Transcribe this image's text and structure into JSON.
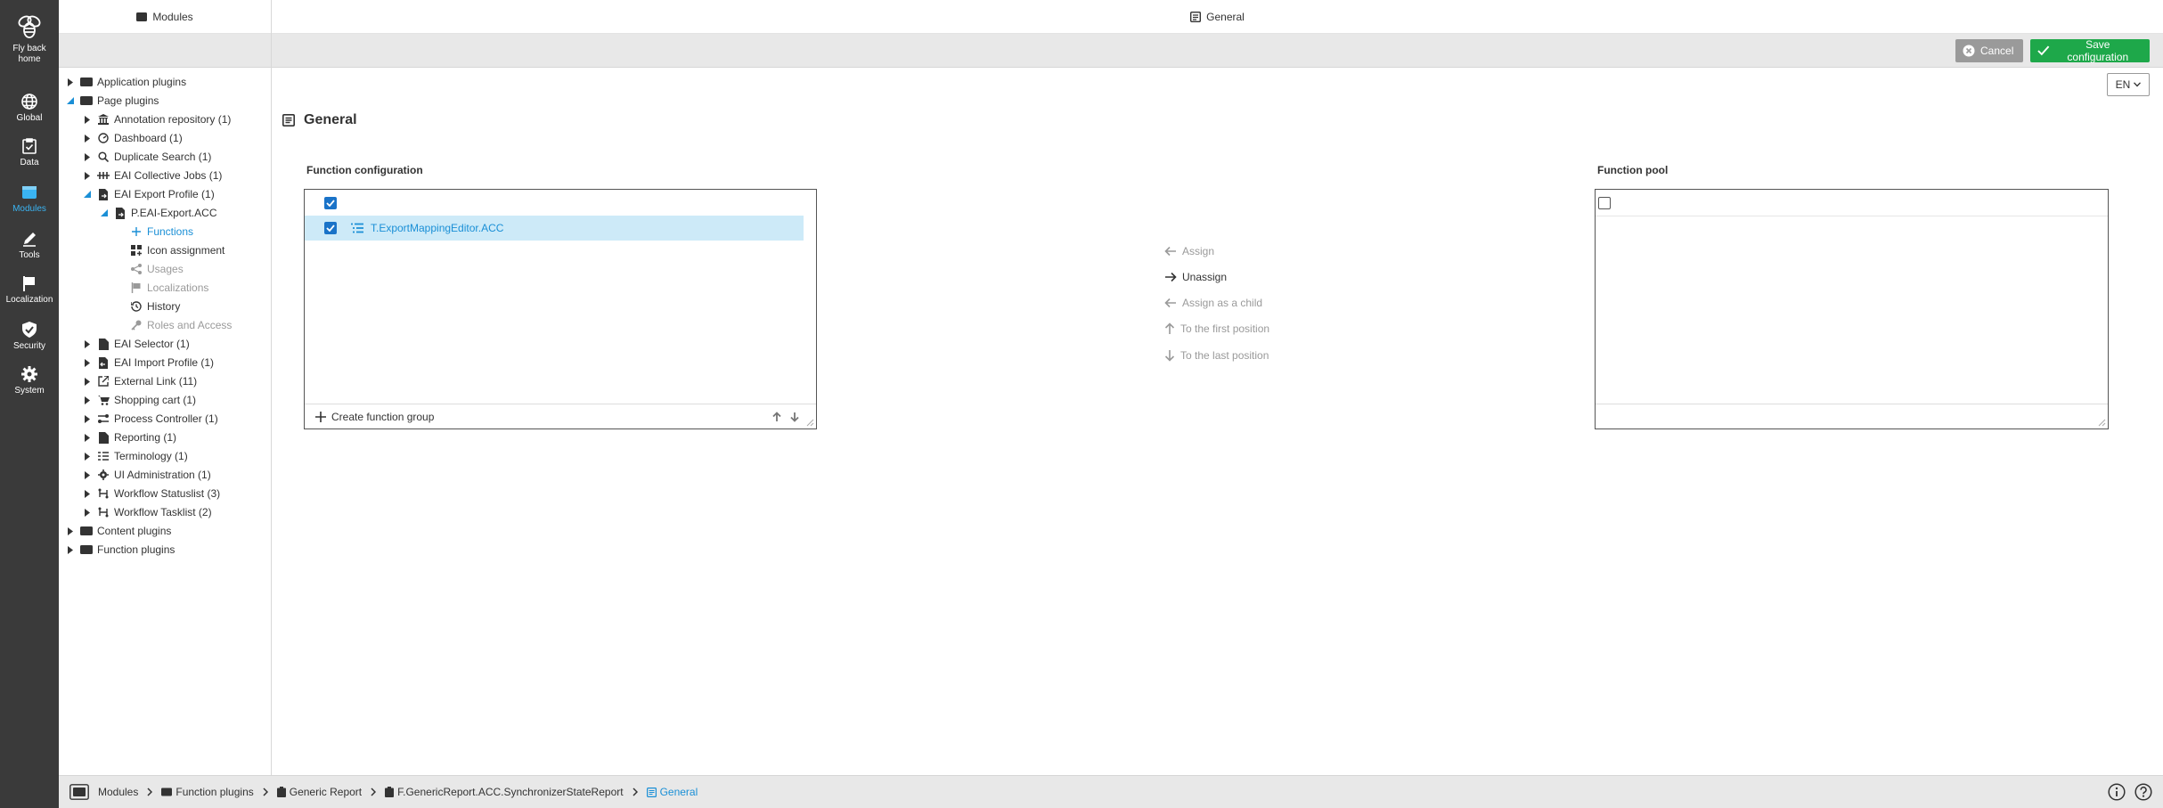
{
  "rail": {
    "items": [
      {
        "label1": "Fly back",
        "label2": "home",
        "icon": "bee-icon"
      },
      {
        "label": "Global",
        "icon": "globe-icon"
      },
      {
        "label": "Data",
        "icon": "clipboard-check-icon"
      },
      {
        "label": "Modules",
        "icon": "modules-icon",
        "active": true
      },
      {
        "label": "Tools",
        "icon": "pencil-icon"
      },
      {
        "label": "Localization",
        "icon": "flag-icon"
      },
      {
        "label": "Security",
        "icon": "shield-check-icon"
      },
      {
        "label": "System",
        "icon": "gear-icon"
      }
    ]
  },
  "sidebar": {
    "title": "Modules",
    "tree": [
      {
        "label": "Application plugins"
      },
      {
        "label": "Page plugins"
      },
      {
        "label": "Annotation repository (1)"
      },
      {
        "label": "Dashboard (1)"
      },
      {
        "label": "Duplicate Search (1)"
      },
      {
        "label": "EAI Collective Jobs (1)"
      },
      {
        "label": "EAI Export Profile (1)"
      },
      {
        "label": "P.EAI-Export.ACC"
      },
      {
        "label": "Functions"
      },
      {
        "label": "Icon assignment"
      },
      {
        "label": "Usages"
      },
      {
        "label": "Localizations"
      },
      {
        "label": "History"
      },
      {
        "label": "Roles and Access"
      },
      {
        "label": "EAI Selector (1)"
      },
      {
        "label": "EAI Import Profile (1)"
      },
      {
        "label": "External Link (11)"
      },
      {
        "label": "Shopping cart (1)"
      },
      {
        "label": "Process Controller (1)"
      },
      {
        "label": "Reporting (1)"
      },
      {
        "label": "Terminology (1)"
      },
      {
        "label": "UI Administration (1)"
      },
      {
        "label": "Workflow Statuslist (3)"
      },
      {
        "label": "Workflow Tasklist (2)"
      },
      {
        "label": "Content plugins"
      },
      {
        "label": "Function plugins"
      }
    ]
  },
  "main": {
    "header_title": "General",
    "cancel_label": "Cancel",
    "save_label": "Save configuration",
    "language": "EN",
    "page_title": "General",
    "function_configuration": {
      "label": "Function configuration",
      "items": [
        {
          "label": "T.ExportMappingEditor.ACC",
          "checked": true
        }
      ],
      "create_group_label": "Create function group"
    },
    "function_pool": {
      "label": "Function pool"
    },
    "actions": {
      "assign": "Assign",
      "unassign": "Unassign",
      "assign_child": "Assign as a child",
      "first_position": "To the first position",
      "last_position": "To the last position"
    }
  },
  "breadcrumb": {
    "items": [
      {
        "label": "Modules"
      },
      {
        "label": "Function plugins"
      },
      {
        "label": "Generic Report"
      },
      {
        "label": "F.GenericReport.ACC.SynchronizerStateReport"
      },
      {
        "label": "General"
      }
    ]
  },
  "colors": {
    "rail_bg": "#3a3a3a",
    "accent": "#1a8fd6",
    "save_green": "#1ea84a",
    "cancel_gray": "#9a9a9a",
    "selected_row": "#cdeaf8"
  }
}
